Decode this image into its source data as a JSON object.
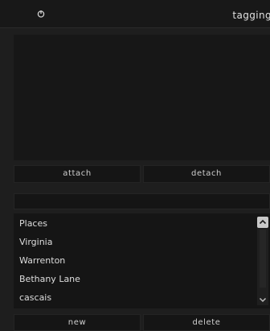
{
  "header": {
    "power_icon": "power-icon",
    "title": "tagging"
  },
  "buttons": {
    "attach": "attach",
    "detach": "detach",
    "new": "new",
    "delete": "delete"
  },
  "entry": {
    "value": ""
  },
  "tag_list": {
    "items": [
      "Places",
      "Virginia",
      "Warrenton",
      "Bethany Lane",
      "cascais"
    ],
    "scroll_up_icon": "chevron-up-icon",
    "scroll_down_icon": "chevron-down-icon"
  }
}
